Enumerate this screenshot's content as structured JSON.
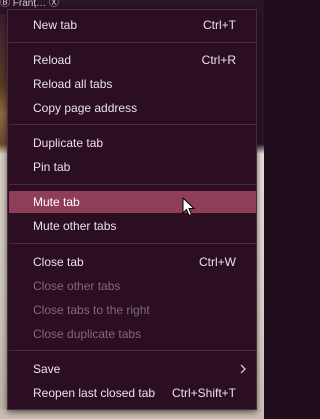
{
  "background": {
    "tab_strip_text": "Ⓑ    Franț…    Ⓧ"
  },
  "menu": {
    "items": [
      {
        "label": "New tab",
        "shortcut": "Ctrl+T"
      },
      {
        "label": "Reload",
        "shortcut": "Ctrl+R"
      },
      {
        "label": "Reload all tabs",
        "shortcut": ""
      },
      {
        "label": "Copy page address",
        "shortcut": ""
      },
      {
        "label": "Duplicate tab",
        "shortcut": ""
      },
      {
        "label": "Pin tab",
        "shortcut": ""
      },
      {
        "label": "Mute tab",
        "shortcut": "",
        "state": "highlighted"
      },
      {
        "label": "Mute other tabs",
        "shortcut": ""
      },
      {
        "label": "Close tab",
        "shortcut": "Ctrl+W"
      },
      {
        "label": "Close other tabs",
        "shortcut": "",
        "state": "disabled"
      },
      {
        "label": "Close tabs to the right",
        "shortcut": "",
        "state": "disabled"
      },
      {
        "label": "Close duplicate tabs",
        "shortcut": "",
        "state": "disabled"
      },
      {
        "label": "Save",
        "shortcut": "",
        "submenu": true
      },
      {
        "label": "Reopen last closed tab",
        "shortcut": "Ctrl+Shift+T"
      }
    ]
  },
  "colors": {
    "menu_bg": "#2b0e22",
    "highlight": "#8e3f57",
    "text": "#ece2ea",
    "disabled_text": "#7e6a78"
  }
}
